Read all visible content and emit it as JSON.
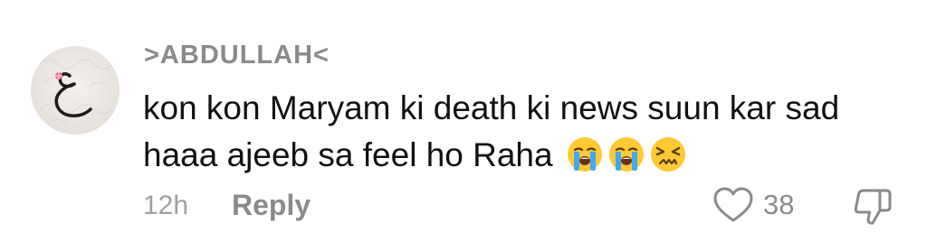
{
  "comment": {
    "username": ">ABDULLAH<",
    "avatar_icon": "arabic-letter-ain-avatar",
    "text_lines": [
      "kon kon Maryam ki death ki news suun kar sad",
      "haaa ajeeb sa feel ho Raha"
    ],
    "emojis": [
      "loudly-crying-face",
      "loudly-crying-face",
      "tired-face"
    ],
    "time": "12h",
    "reply_label": "Reply",
    "like_count": "38",
    "like_icon": "heart-outline-icon",
    "dislike_icon": "thumbs-down-outline-icon"
  }
}
